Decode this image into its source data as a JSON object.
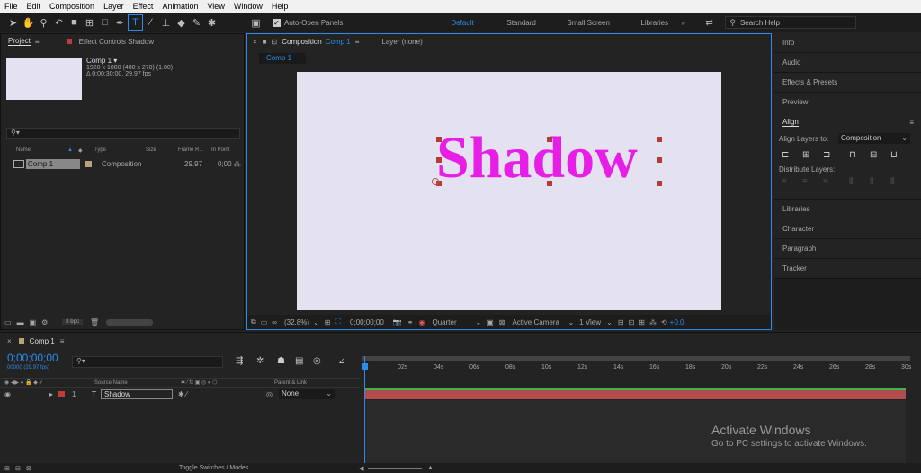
{
  "menu": [
    "File",
    "Edit",
    "Composition",
    "Layer",
    "Effect",
    "Animation",
    "View",
    "Window",
    "Help"
  ],
  "toolbar": {
    "auto_open": "Auto-Open Panels",
    "workspaces": [
      "Default",
      "Standard",
      "Small Screen",
      "Libraries"
    ],
    "search": "Search Help",
    "tool_icons": [
      "selection-icon",
      "hand-icon",
      "zoom-icon",
      "rotate-icon",
      "camera-icon",
      "pan-behind-icon",
      "rectangle-icon",
      "pen-icon",
      "type-icon",
      "brush-icon",
      "clone-stamp-icon",
      "eraser-icon",
      "roto-brush-icon",
      "puppet-icon"
    ]
  },
  "project": {
    "tab": "Project",
    "effect_tab": "Effect Controls Shadow",
    "comp_name": "Comp 1 ▾",
    "comp_info1": "1920 x 1080 (480 x 270) (1.00)",
    "comp_info2": "Δ 0;00;30;00, 29.97 fps",
    "columns": [
      "Name",
      "Type",
      "Size",
      "Frame R...",
      "In Point"
    ],
    "row": {
      "name": "Comp 1",
      "type": "Composition",
      "fps": "29.97",
      "in": "0;00"
    },
    "bpc": "8 bpc"
  },
  "composition": {
    "tab": "Composition",
    "tab_name": "Comp 1",
    "layer_tab": "Layer (none)",
    "sub_tab": "Comp 1",
    "text": "Shadow",
    "zoom": "(32.8%)",
    "time": "0;00;00;00",
    "quality": "Quarter",
    "camera": "Active Camera",
    "view": "1 View",
    "exposure": "+0.0"
  },
  "right_panel": {
    "items_top": [
      "Info",
      "Audio",
      "Effects & Presets",
      "Preview"
    ],
    "align": {
      "title": "Align",
      "align_to_label": "Align Layers to:",
      "align_to_value": "Composition",
      "distribute": "Distribute Layers:"
    },
    "items_bottom": [
      "Libraries",
      "Character",
      "Paragraph",
      "Tracker"
    ]
  },
  "timeline": {
    "tab": "Comp 1",
    "timecode": "0;00;00;00",
    "sub_time": "00000 (29.97 fps)",
    "columns": {
      "source": "Source Name",
      "parent": "Parent & Link"
    },
    "layer": {
      "num": "1",
      "name": "Shadow",
      "parent": "None"
    },
    "ticks": [
      "0s",
      "02s",
      "04s",
      "06s",
      "08s",
      "10s",
      "12s",
      "14s",
      "16s",
      "18s",
      "20s",
      "22s",
      "24s",
      "26s",
      "28s",
      "30s"
    ],
    "toggle": "Toggle Switches / Modes"
  },
  "watermark": {
    "title": "Activate Windows",
    "subtitle": "Go to PC settings to activate Windows."
  },
  "colors": {
    "accent": "#2d8ceb",
    "text_magenta": "#e61ee6",
    "layer_bar": "#b24c4c",
    "handle": "#b53b3b"
  }
}
